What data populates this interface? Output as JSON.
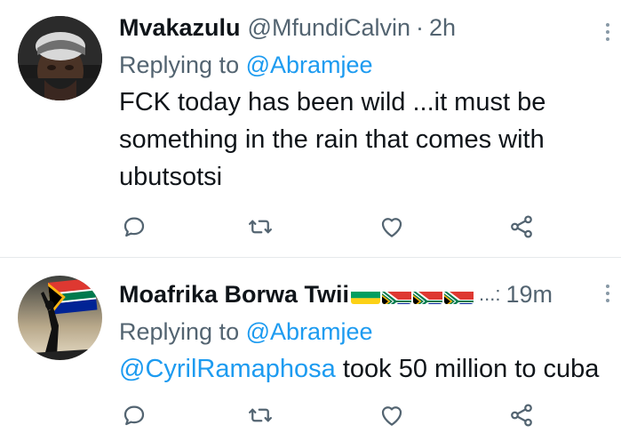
{
  "tweets": [
    {
      "name": "Mvakazulu",
      "handle": "@MfundiCalvin",
      "separator": "·",
      "time": "2h",
      "replying_prefix": "Replying to",
      "replying_to": "@Abramjee",
      "text_lines": [
        "FCK today has been wild ...it must be",
        "something in the rain that comes with",
        "ubutsotsi"
      ]
    },
    {
      "name": "Moafrika Borwa Twii",
      "flags": [
        "gabon-flag-icon",
        "south-africa-flag-icon",
        "south-africa-flag-icon",
        "south-africa-flag-icon"
      ],
      "handle_truncated": "...:",
      "time": "19m",
      "replying_prefix": "Replying to",
      "replying_to": "@Abramjee",
      "mention": "@CyrilRamaphosa",
      "text_rest": " took 50 million to cuba"
    }
  ],
  "actions": [
    "reply-icon",
    "retweet-icon",
    "like-icon",
    "share-icon"
  ],
  "colors": {
    "link": "#1d9bf0",
    "secondary_text": "#536471",
    "icon": "#536471",
    "divider": "#e6e9ec"
  }
}
